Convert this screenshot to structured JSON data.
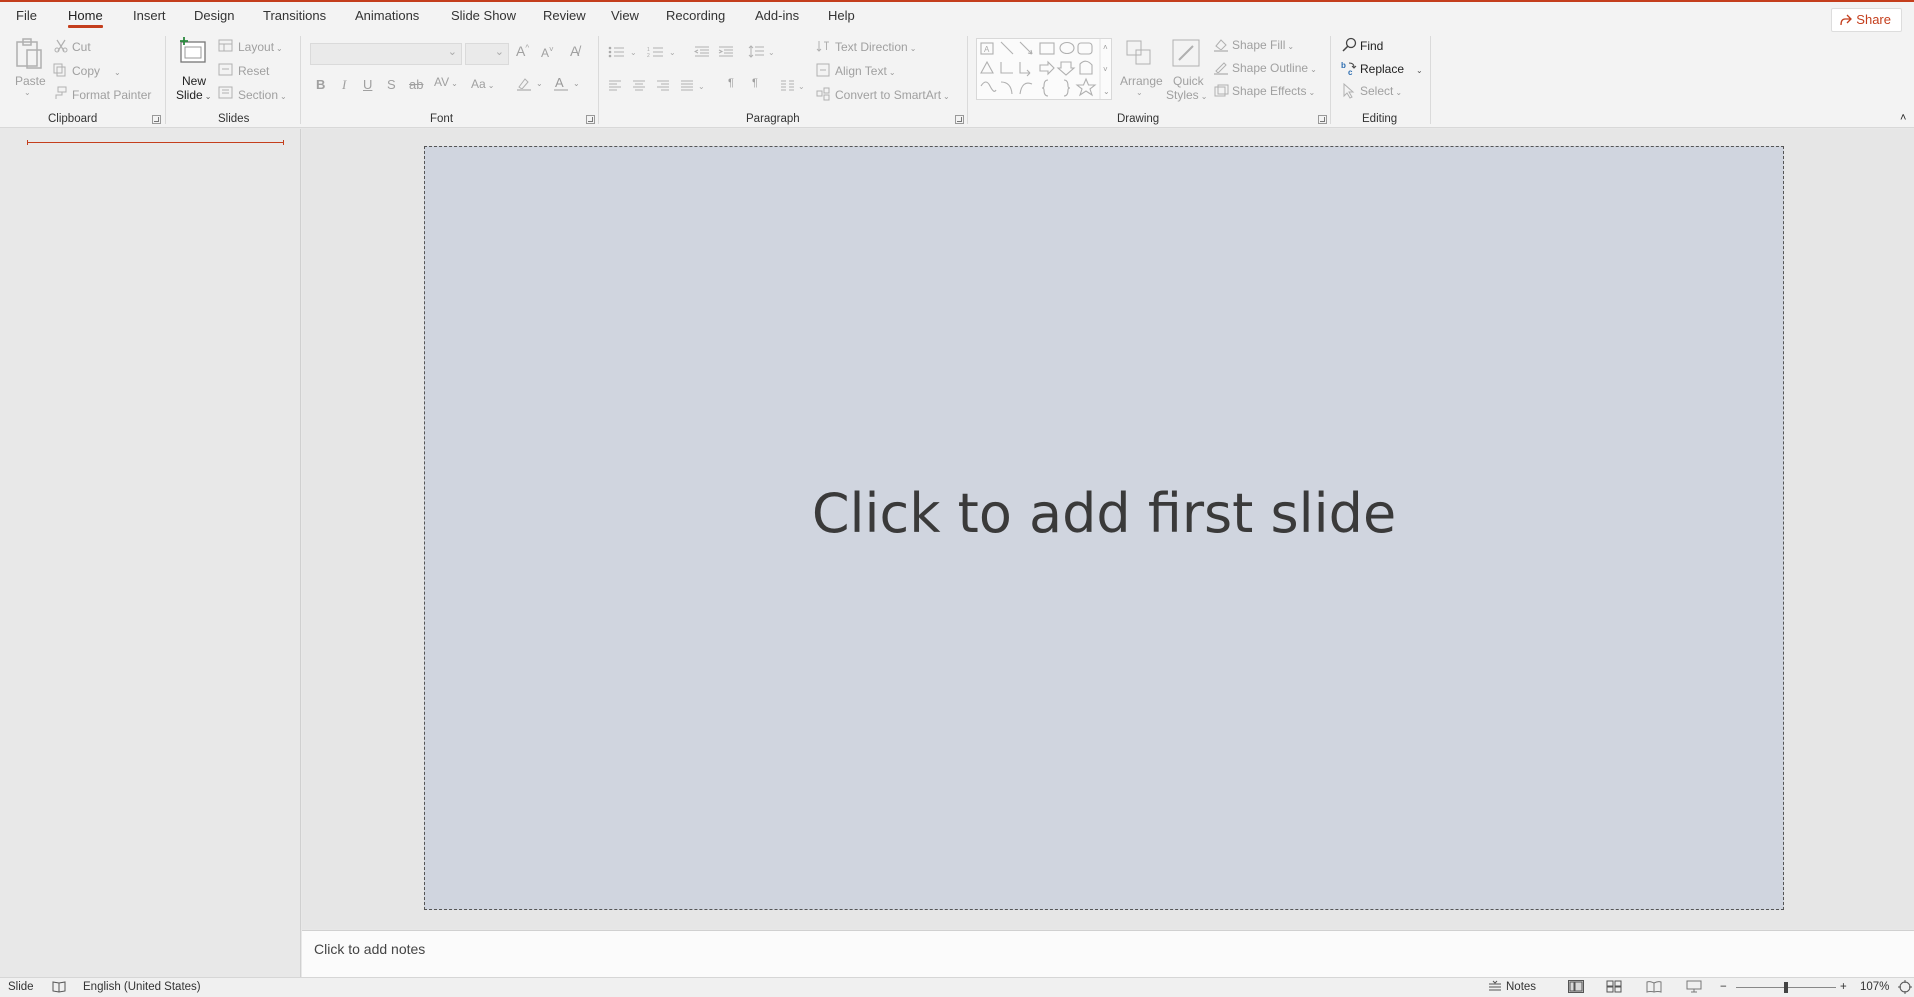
{
  "accent": "#c43e1c",
  "tabs": [
    "File",
    "Home",
    "Insert",
    "Design",
    "Transitions",
    "Animations",
    "Slide Show",
    "Review",
    "View",
    "Recording",
    "Add-ins",
    "Help"
  ],
  "share_label": "Share",
  "clipboard": {
    "paste": "Paste",
    "cut": "Cut",
    "copy": "Copy",
    "format_painter": "Format Painter",
    "group": "Clipboard"
  },
  "slides": {
    "new_slide_line1": "New",
    "new_slide_line2": "Slide",
    "layout": "Layout",
    "reset": "Reset",
    "section": "Section",
    "group": "Slides"
  },
  "font": {
    "group": "Font"
  },
  "paragraph": {
    "text_direction": "Text Direction",
    "align_text": "Align Text",
    "convert_smartart": "Convert to SmartArt",
    "group": "Paragraph"
  },
  "drawing": {
    "arrange": "Arrange",
    "quick_styles_line1": "Quick",
    "quick_styles_line2": "Styles",
    "shape_fill": "Shape Fill",
    "shape_outline": "Shape Outline",
    "shape_effects": "Shape Effects",
    "group": "Drawing"
  },
  "editing": {
    "find": "Find",
    "replace": "Replace",
    "select": "Select",
    "group": "Editing"
  },
  "slide_placeholder": "Click to add first slide",
  "notes_placeholder": "Click to add notes",
  "status": {
    "view": "Slide",
    "language": "English (United States)",
    "notes": "Notes",
    "zoom": "107%"
  }
}
